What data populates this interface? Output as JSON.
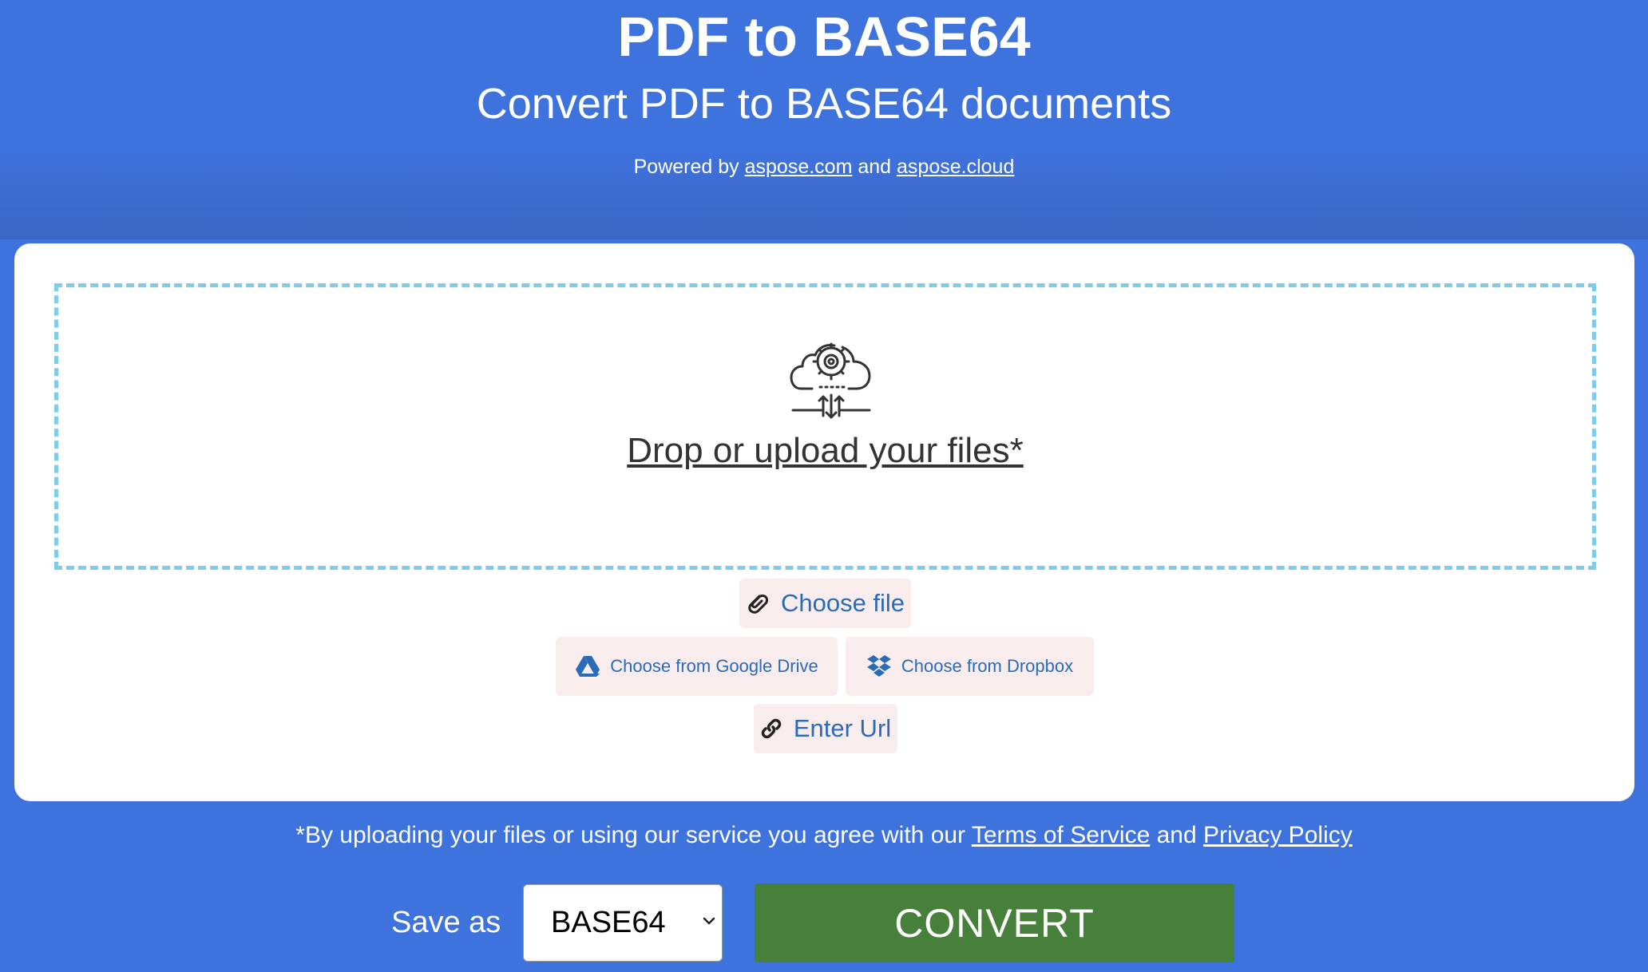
{
  "header": {
    "title": "PDF to BASE64",
    "subtitle": "Convert PDF to BASE64 documents",
    "powered_prefix": "Powered by",
    "link1": "aspose.com",
    "and": "and",
    "link2": "aspose.cloud"
  },
  "upload": {
    "drop_label": "Drop or upload your files*",
    "choose_file": "Choose file",
    "google_drive": "Choose from Google Drive",
    "dropbox": "Choose from Dropbox",
    "enter_url": "Enter Url"
  },
  "agreement": {
    "text": "*By uploading your files or using our service you agree with our",
    "terms": "Terms of Service",
    "and": "and",
    "privacy": "Privacy Policy"
  },
  "footer": {
    "save_as_label": "Save as",
    "format_value": "BASE64",
    "convert_label": "CONVERT"
  },
  "icons": {
    "upload": "cloud-gear-icon",
    "choose_file": "paperclip-icon",
    "google_drive": "google-drive-icon",
    "dropbox": "dropbox-icon",
    "enter_url": "link-icon",
    "select": "chevron-down-icon"
  },
  "colors": {
    "background": "#3e72dd",
    "card": "#ffffff",
    "dropzone_border": "#7fcbe9",
    "button_bg": "#f8ecec",
    "button_text": "#2a6bb7",
    "convert_bg": "#46803a"
  }
}
